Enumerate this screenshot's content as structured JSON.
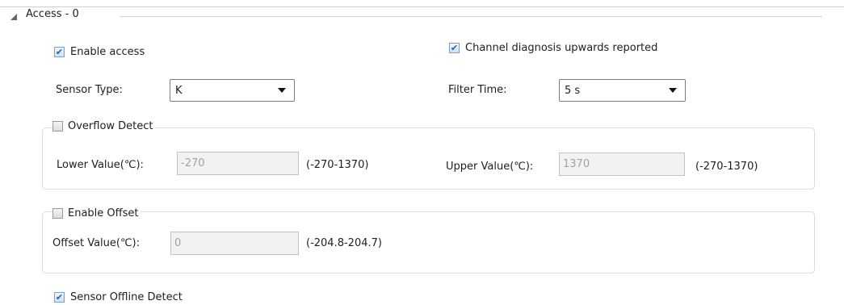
{
  "section": {
    "title": "Access - 0"
  },
  "enable_access": {
    "label": "Enable access",
    "checked": true
  },
  "channel_diagnosis": {
    "label": "Channel diagnosis upwards reported",
    "checked": true
  },
  "sensor_type": {
    "label": "Sensor Type:",
    "value": "K"
  },
  "filter_time": {
    "label": "Filter Time:",
    "value": "5 s"
  },
  "overflow": {
    "label": "Overflow Detect",
    "checked": false,
    "lower_label": "Lower Value(℃):",
    "lower_value": "-270",
    "lower_range": "(-270-1370)",
    "upper_label": "Upper Value(℃):",
    "upper_value": "1370",
    "upper_range": "(-270-1370)"
  },
  "offset": {
    "label": "Enable Offset",
    "checked": false,
    "value_label": "Offset Value(℃):",
    "value": "0",
    "range": "(-204.8-204.7)"
  },
  "sensor_offline": {
    "label": "Sensor Offline Detect",
    "checked": true
  },
  "icons": {
    "check": "✔",
    "collapse": "collapse-triangle-icon",
    "dropdown": "chevron-down-icon"
  }
}
